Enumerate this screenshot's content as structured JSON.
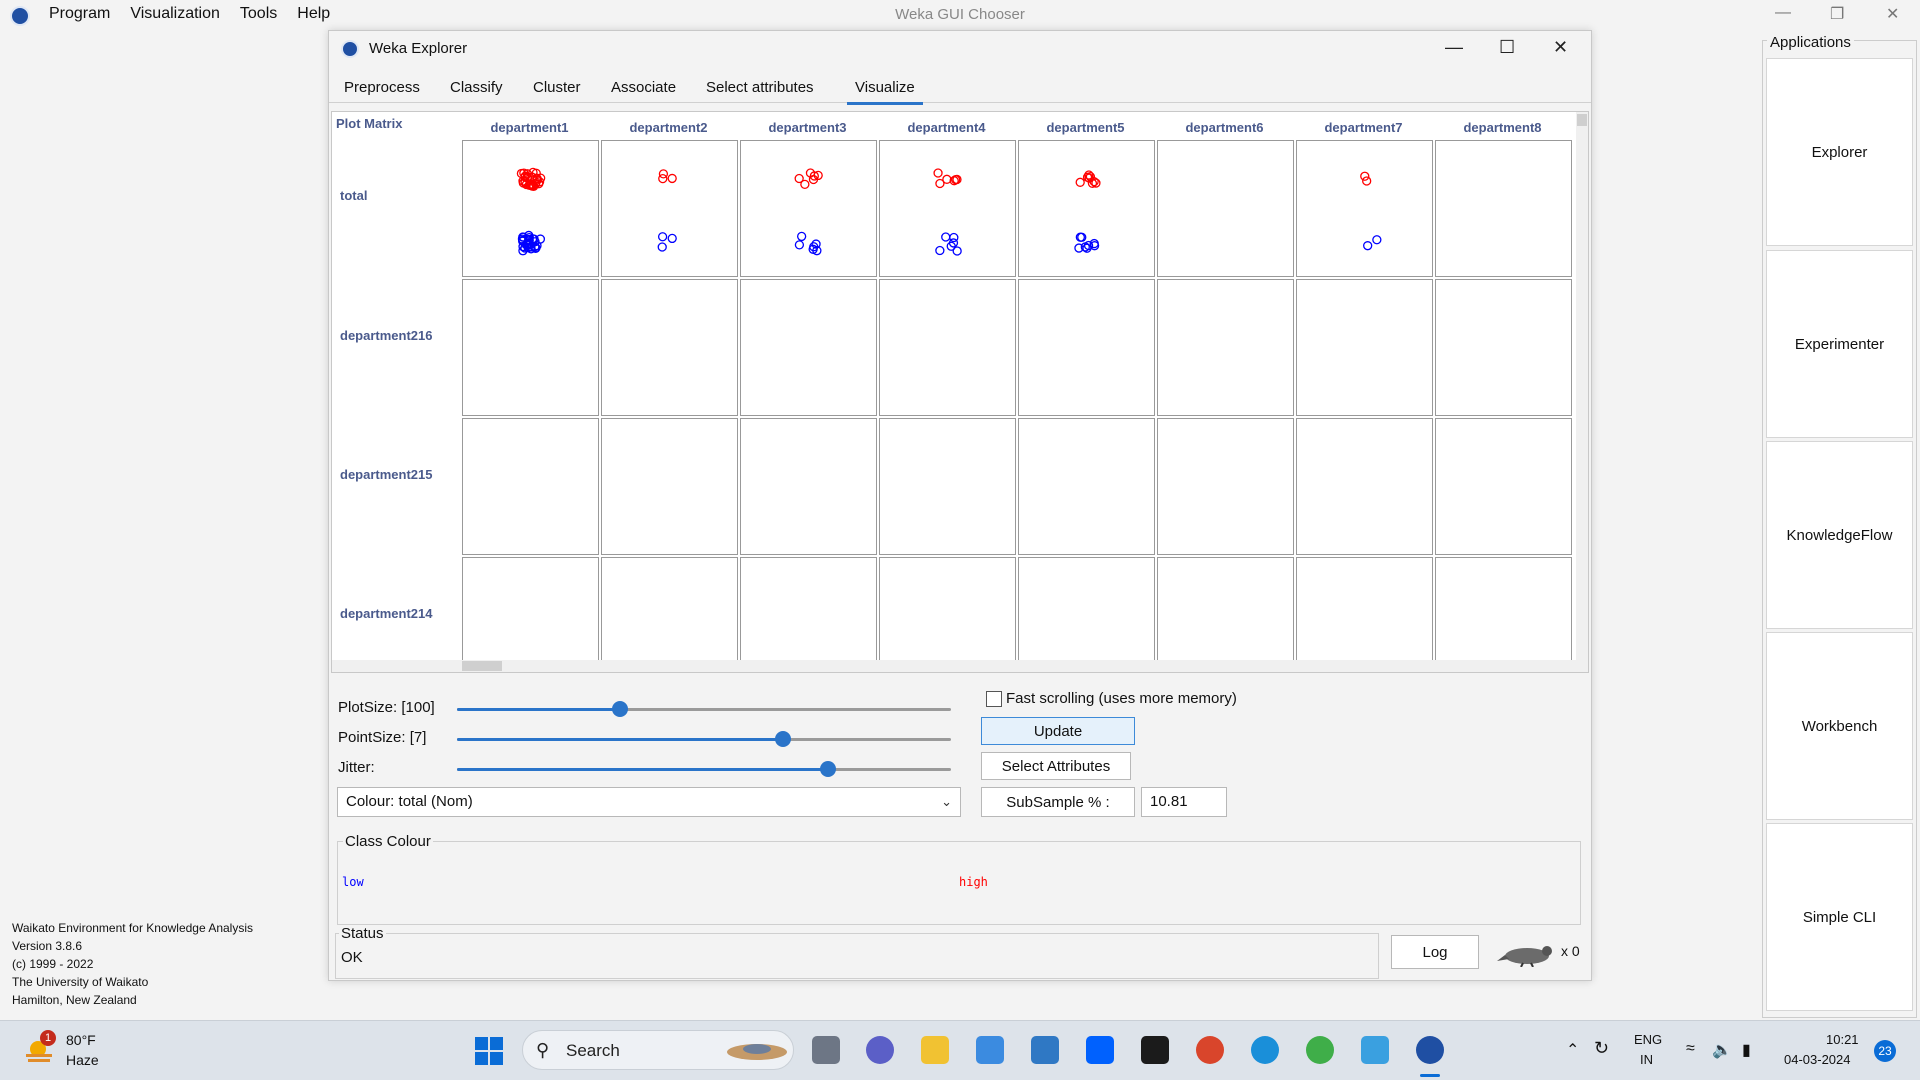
{
  "chooser": {
    "menu": [
      "Program",
      "Visualization",
      "Tools",
      "Help"
    ],
    "title": "Weka GUI Chooser",
    "controls": {
      "minimize": "—",
      "maximize": "❐",
      "close": "✕"
    }
  },
  "applications": {
    "title": "Applications",
    "buttons": [
      "Explorer",
      "Experimenter",
      "KnowledgeFlow",
      "Workbench",
      "Simple CLI"
    ]
  },
  "weka_info": [
    "Waikato Environment for Knowledge Analysis",
    "Version 3.8.6",
    "(c) 1999 - 2022",
    "The University of Waikato",
    "Hamilton, New Zealand"
  ],
  "explorer": {
    "title": "Weka Explorer",
    "controls": {
      "minimize": "—",
      "maximize": "☐",
      "close": "✕"
    },
    "tabs": [
      "Preprocess",
      "Classify",
      "Cluster",
      "Associate",
      "Select attributes",
      "Visualize"
    ],
    "active_tab": "Visualize"
  },
  "plot_matrix": {
    "label": "Plot Matrix",
    "columns": [
      "department1",
      "department2",
      "department3",
      "department4",
      "department5",
      "department6",
      "department7",
      "department8"
    ],
    "rows": [
      "total",
      "department216",
      "department215",
      "department214"
    ],
    "class_colors": {
      "low": "#0000ff",
      "high": "#ff0000"
    }
  },
  "controls": {
    "plot_size": {
      "label": "PlotSize: [100]",
      "level": 0.33
    },
    "point_size": {
      "label": "PointSize: [7]",
      "level": 0.66
    },
    "jitter": {
      "label": "Jitter:",
      "level": 0.75
    },
    "fast_scrolling": "Fast scrolling (uses more memory)",
    "update": "Update",
    "select_attributes": "Select Attributes",
    "colour": "Colour: total  (Nom)",
    "subsample_label": "SubSample % :",
    "subsample_value": "10.81"
  },
  "class_colour": {
    "title": "Class Colour",
    "low": "low",
    "high": "high"
  },
  "status": {
    "title": "Status",
    "text": "OK",
    "log": "Log",
    "x_count": "x 0"
  },
  "taskbar": {
    "weather_badge": "1",
    "temperature": "80°F",
    "condition": "Haze",
    "search": "Search",
    "language_top": "ENG",
    "language_bottom": "IN",
    "time": "10:21",
    "date": "04-03-2024",
    "notification_count": "23"
  }
}
